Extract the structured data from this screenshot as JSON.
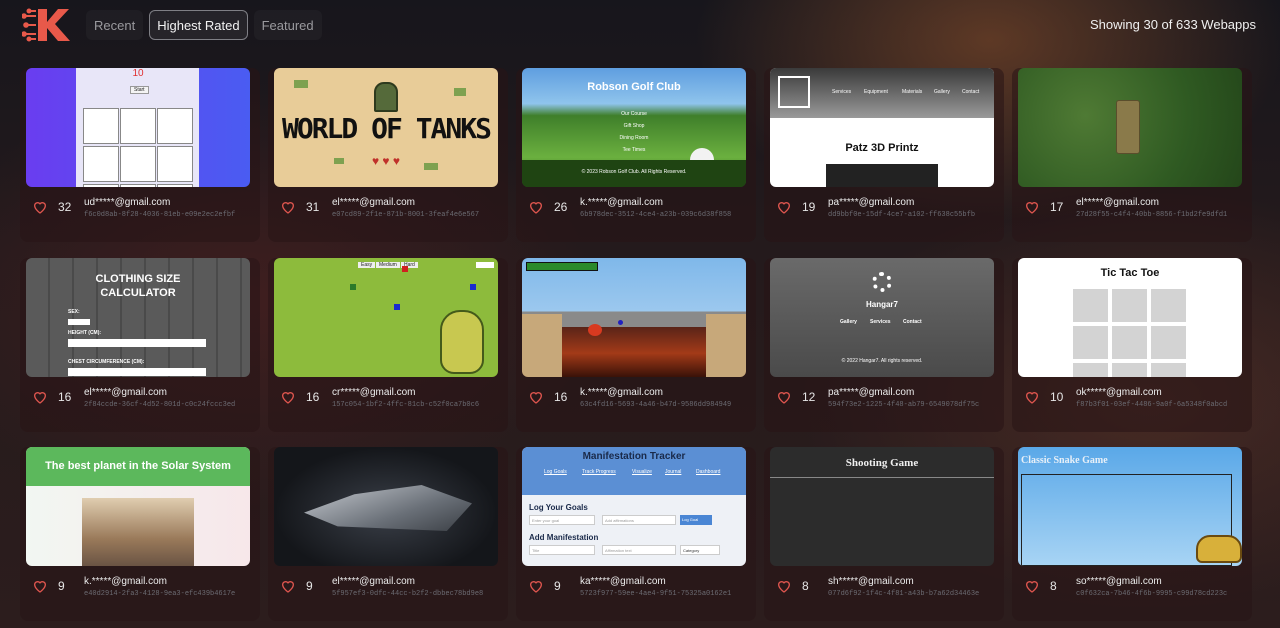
{
  "header": {
    "tabs": [
      {
        "label": "Recent",
        "active": false
      },
      {
        "label": "Highest Rated",
        "active": true
      },
      {
        "label": "Featured",
        "active": false
      }
    ],
    "count_text": "Showing 30 of 633 Webapps"
  },
  "colors": {
    "accent": "#e8594a",
    "heart": "#e0564f"
  },
  "apps": [
    {
      "likes": "32",
      "email": "ud*****@gmail.com",
      "hash": "f6c0d8ab-8f28-4036-81eb-e09e2ec2efbf",
      "thumb": {
        "score": "10",
        "button": "Start"
      }
    },
    {
      "likes": "31",
      "email": "el*****@gmail.com",
      "hash": "e07cd89-2f1e-871b-8001-3feaf4e6e567",
      "thumb": {
        "title": "WORLD OF TANKS"
      }
    },
    {
      "likes": "26",
      "email": "k.*****@gmail.com",
      "hash": "6b978dec-3512-4ce4-a23b-039c6d38f858",
      "thumb": {
        "title": "Robson Golf Club",
        "links": [
          "Our Course",
          "Gift Shop",
          "Dining Room",
          "Tee Times"
        ],
        "footer": "© 2023 Robson Golf Club. All Rights Reserved."
      }
    },
    {
      "likes": "19",
      "email": "pa*****@gmail.com",
      "hash": "dd9bbf0e-15df-4ce7-a102-ff638c55bfb",
      "thumb": {
        "nav": [
          "Services",
          "Equipment",
          "Materials",
          "Gallery",
          "Contact"
        ],
        "title": "Patz 3D Printz"
      }
    },
    {
      "likes": "17",
      "email": "el*****@gmail.com",
      "hash": "27d28f55-c4f4-40bb-8856-f1bd2fe9dfd1",
      "thumb": {}
    },
    {
      "likes": "16",
      "email": "el*****@gmail.com",
      "hash": "2f84ccde-36cf-4d52-801d-c0c24fccc3ed",
      "thumb": {
        "title": "CLOTHING SIZE CALCULATOR",
        "labels": [
          "SEX:",
          "HEIGHT (CM):",
          "CHEST CIRCUMFERENCE (CM):"
        ]
      }
    },
    {
      "likes": "16",
      "email": "cr*****@gmail.com",
      "hash": "157c054-1bf2-4ffc-81cb-c52f0ca7b0c6",
      "thumb": {
        "buttons": [
          "Easy",
          "Medium",
          "Hard"
        ]
      }
    },
    {
      "likes": "16",
      "email": "k.*****@gmail.com",
      "hash": "63c4fd16-5693-4a46-b47d-9586dd984949",
      "thumb": {}
    },
    {
      "likes": "12",
      "email": "pa*****@gmail.com",
      "hash": "594f73e2-1225-4f48-ab79-6549078df75c",
      "thumb": {
        "title": "Hangar7",
        "nav": [
          "Gallery",
          "Services",
          "Contact"
        ],
        "footer": "© 2022 Hangar7. All rights reserved."
      }
    },
    {
      "likes": "10",
      "email": "ok*****@gmail.com",
      "hash": "f87b3f01-03ef-4486-9a0f-6a5348f0abcd",
      "thumb": {
        "title": "Tic Tac Toe"
      }
    },
    {
      "likes": "9",
      "email": "k.*****@gmail.com",
      "hash": "e40d2914-2fa3-4128-9ea3-efc439b4617e",
      "thumb": {
        "title": "The best planet in the Solar System"
      }
    },
    {
      "likes": "9",
      "email": "el*****@gmail.com",
      "hash": "5f957ef3-0dfc-44cc-b2f2-dbbec78bd9e8",
      "thumb": {}
    },
    {
      "likes": "9",
      "email": "ka*****@gmail.com",
      "hash": "5723f977-59ee-4ae4-9f51-75325a0162e1",
      "thumb": {
        "title": "Manifestation Tracker",
        "nav": [
          "Log Goals",
          "Track Progress",
          "Visualize",
          "Journal",
          "Dashboard"
        ],
        "h1": "Log Your Goals",
        "h2": "Add Manifestation",
        "button": "Log Goal",
        "ph1": "Enter your goal",
        "ph2": "Add affirmations",
        "ph3": "Title",
        "ph4": "Affirmation text",
        "select": "Category"
      }
    },
    {
      "likes": "8",
      "email": "sh*****@gmail.com",
      "hash": "077d6f92-1f4c-4f81-a43b-b7a62d34463e",
      "thumb": {
        "title": "Shooting Game"
      }
    },
    {
      "likes": "8",
      "email": "so*****@gmail.com",
      "hash": "c0f632ca-7b46-4f6b-9995-c99d78cd223c",
      "thumb": {
        "title": "Classic Snake Game"
      }
    }
  ]
}
